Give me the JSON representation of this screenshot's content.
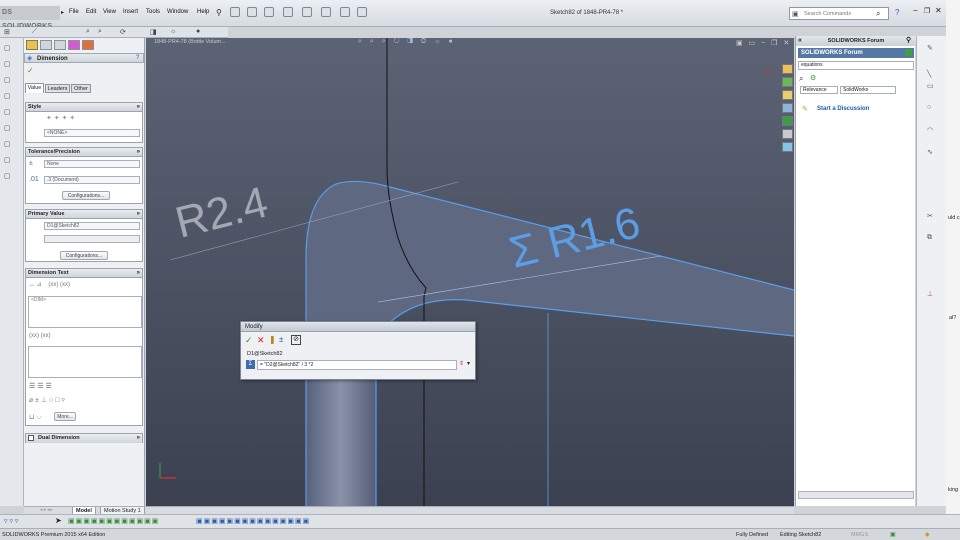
{
  "app": {
    "logo_text": "DS SOLIDWORKS",
    "brand_color": "#c0272d"
  },
  "menu": [
    "File",
    "Edit",
    "View",
    "Insert",
    "Tools",
    "Window",
    "Help"
  ],
  "document_title": "Sketch82 of 1848-PR4-78 *",
  "search": {
    "placeholder": "Search Commands"
  },
  "property_manager": {
    "title": "Dimension",
    "tabs": [
      "Value",
      "Leaders",
      "Other"
    ],
    "style": {
      "header": "Style",
      "dropdown": "<NONE>"
    },
    "tolerance": {
      "header": "Tolerance/Precision",
      "tolerance_value": "None",
      "precision_value": ".3 (Document)",
      "config_button": "Configurations..."
    },
    "primary": {
      "header": "Primary Value",
      "name_value": "D1@Sketch82",
      "config_button": "Configurations..."
    },
    "dimtext": {
      "header": "Dimension Text",
      "text_value": "<DIM>",
      "more_button": "More..."
    },
    "dual": {
      "header": "Dual Dimension"
    }
  },
  "viewport": {
    "tree_label": "1848-PR4-78 (Bottle Volum...",
    "dim_r24": "R2.4",
    "dim_r16": "Σ R1.6",
    "accent_color": "#5b9ee6"
  },
  "modify_dialog": {
    "title": "Modify",
    "dimension_name": "D1@Sketch82",
    "equation": "= \"D2@Sketch82\" / 3 *2"
  },
  "task_pane": {
    "header": "SOLIDWORKS Forum",
    "title": "SOLIDWORKS Forum",
    "search_value": "equations",
    "sort_value": "Relevance",
    "scope_value": "SolidWorks",
    "link": "Start a Discussion"
  },
  "bottom_tabs": [
    "Model",
    "Motion Study 1"
  ],
  "status": {
    "edition": "SOLIDWORKS Premium 2015 x64 Edition",
    "defined": "Fully Defined",
    "editing": "Editing Sketch82",
    "units": "MMGS"
  },
  "edge_snippets": [
    "uld c",
    "al?",
    "king"
  ]
}
